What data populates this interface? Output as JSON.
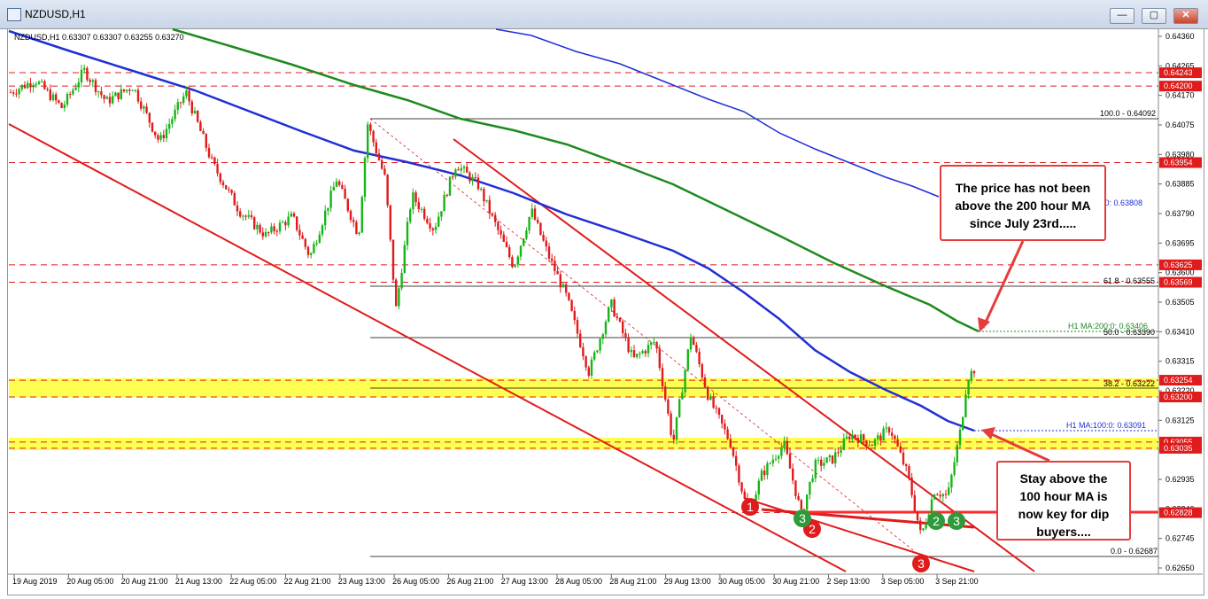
{
  "window": {
    "title": "NZDUSD,H1",
    "minimize": "—",
    "maximize": "▢",
    "close": "✕"
  },
  "chart_header": "NZDUSD,H1  0.63307 0.63307 0.63255 0.63270",
  "price_axis": {
    "ticks": [
      "0.64360",
      "0.64265",
      "0.64170",
      "0.64075",
      "0.63980",
      "0.63885",
      "0.63790",
      "0.63695",
      "0.63600",
      "0.63505",
      "0.63410",
      "0.63315",
      "0.63220",
      "0.63125",
      "0.63030",
      "0.62935",
      "0.62840",
      "0.62745",
      "0.62650"
    ],
    "red_labels": [
      "0.64243",
      "0.64200",
      "0.63954",
      "0.63625",
      "0.63569",
      "0.63254",
      "0.63200",
      "0.63055",
      "0.63035",
      "0.62828"
    ]
  },
  "time_axis": [
    "19 Aug 2019",
    "20 Aug 05:00",
    "20 Aug 21:00",
    "21 Aug 13:00",
    "22 Aug 05:00",
    "22 Aug 21:00",
    "23 Aug 13:00",
    "26 Aug 05:00",
    "26 Aug 21:00",
    "27 Aug 13:00",
    "28 Aug 05:00",
    "28 Aug 21:00",
    "29 Aug 13:00",
    "30 Aug 05:00",
    "30 Aug 21:00",
    "2 Sep 13:00",
    "3 Sep 05:00",
    "3 Sep 21:00"
  ],
  "fib_labels": {
    "f100": "100.0 - 0.64092",
    "f618": "61.8 - 0.63555",
    "f50": "50.0 - 0.63390",
    "f382": "38.2 - 0.63222",
    "f0": "0.0 - 0.62687"
  },
  "ma_labels": {
    "ma200": "H1 MA:200:0: 0.63406",
    "ma100": "H1 MA:100:0: 0.63091",
    "ma_partial": "0:0: 0.63808"
  },
  "markers": [
    "1",
    "2",
    "3",
    "2",
    "3",
    "3"
  ],
  "callouts": {
    "top": "The price has not been above the 200 hour MA since July 23rd.....",
    "bottom": "Stay above the 100 hour MA is now key for dip buyers...."
  },
  "colors": {
    "bull": "#17b517",
    "bear": "#e01b1b",
    "ma100": "#1f2fd4",
    "ma200": "#1f8a1f",
    "ma_blue_upper": "#1f2fd4",
    "support": "#ff0000",
    "zone": "#ffff33"
  }
}
